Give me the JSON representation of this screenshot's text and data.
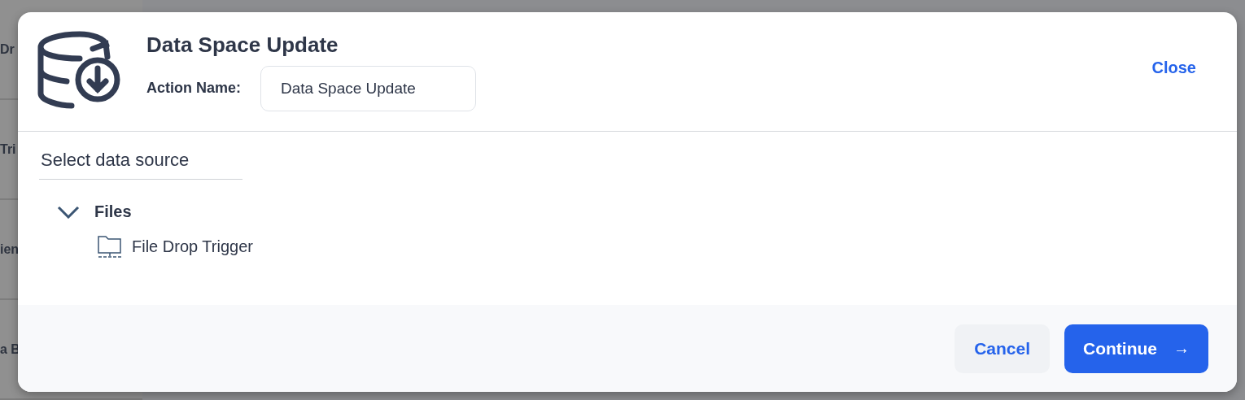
{
  "background": {
    "fragments": [
      "Dr",
      "Tri",
      "ien",
      "a B"
    ]
  },
  "dialog": {
    "title": "Data Space Update",
    "action_name_label": "Action Name:",
    "action_name_value": "Data Space Update",
    "close": "Close",
    "section_title": "Select data source",
    "tree": [
      {
        "label": "Files",
        "expanded": true,
        "children": [
          {
            "label": "File Drop Trigger"
          }
        ]
      }
    ],
    "buttons": [
      {
        "label": "Cancel",
        "kind": "secondary"
      },
      {
        "label": "Continue",
        "kind": "primary",
        "icon": "→"
      }
    ]
  }
}
